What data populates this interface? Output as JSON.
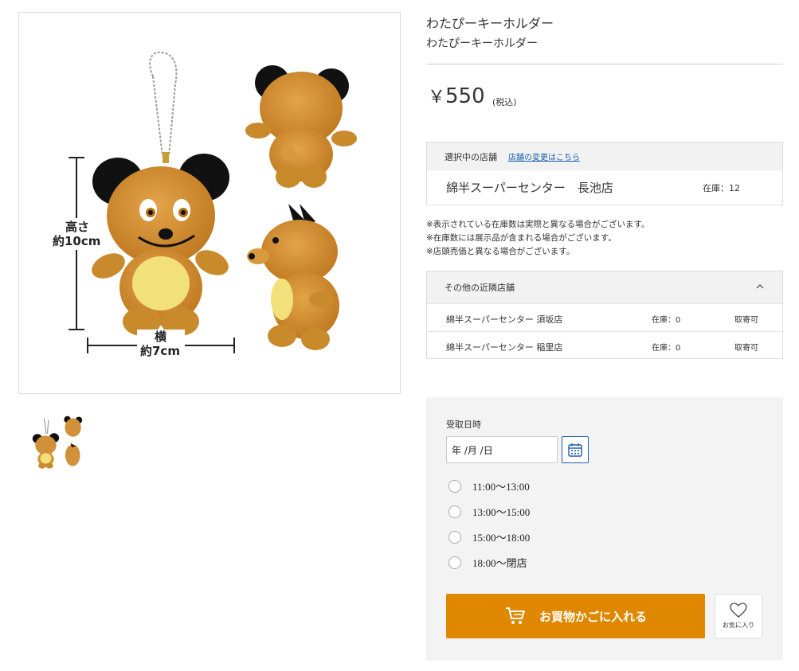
{
  "product": {
    "title": "わたぴーキーホルダー",
    "subtitle": "わたぴーキーホルダー",
    "price_symbol": "￥",
    "price": "550",
    "tax_label": "(税込)"
  },
  "image": {
    "height_label_1": "高さ",
    "height_label_2": "約10cm",
    "width_label_1": "横",
    "width_label_2": "約7cm"
  },
  "store": {
    "header_label": "選択中の店舗",
    "change_link": "店舗の変更はこちら",
    "name": "綿半スーパーセンター　長池店",
    "stock": "在庫：12"
  },
  "notes": [
    "※表示されている在庫数は実際と異なる場合がございます。",
    "※在庫数には展示品が含まれる場合がございます。",
    "※店頭売価と異なる場合がございます。"
  ],
  "nearby": {
    "header": "その他の近隣店舗",
    "stores": [
      {
        "name": "綿半スーパーセンター 須坂店",
        "stock": "在庫：0",
        "order": "取寄可"
      },
      {
        "name": "綿半スーパーセンター 稲里店",
        "stock": "在庫：0",
        "order": "取寄可"
      }
    ]
  },
  "order": {
    "pickup_label": "受取日時",
    "date_placeholder": "年 /月 /日",
    "slots": [
      "11:00〜13:00",
      "13:00〜15:00",
      "15:00〜18:00",
      "18:00〜閉店"
    ],
    "cart_label": "お買物かごに入れる",
    "favorite_label": "お気に入り"
  },
  "icons": {
    "calendar": "calendar-icon",
    "cart": "cart-icon",
    "heart": "heart-icon",
    "chevron": "chevron-up-icon"
  },
  "colors": {
    "accent": "#e08700",
    "link": "#1a5fa8",
    "calendar_border": "#1e5fa3",
    "panel_bg": "#f3f3f3"
  }
}
